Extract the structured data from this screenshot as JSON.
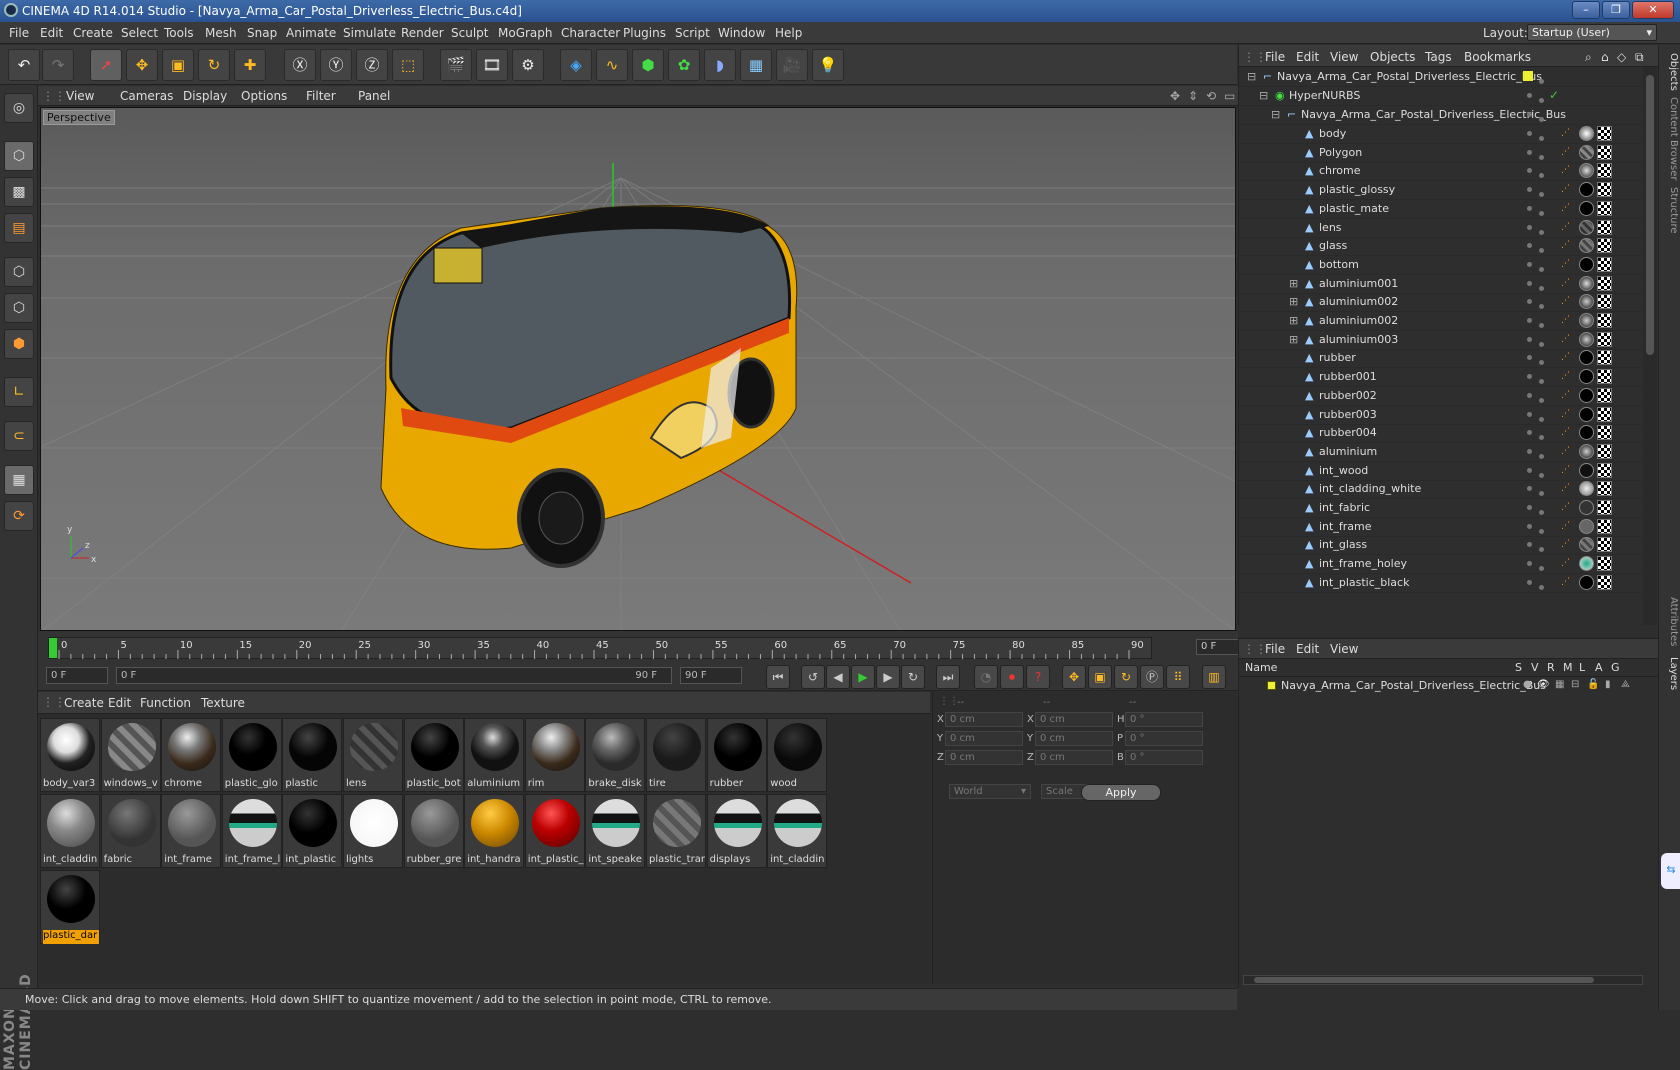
{
  "window": {
    "title": "CINEMA 4D R14.014 Studio - [Navya_Arma_Car_Postal_Driverless_Electric_Bus.c4d]"
  },
  "menu": [
    "File",
    "Edit",
    "Create",
    "Select",
    "Tools",
    "Mesh",
    "Snap",
    "Animate",
    "Simulate",
    "Render",
    "Sculpt",
    "MoGraph",
    "Character",
    "Plugins",
    "Script",
    "Window",
    "Help"
  ],
  "layout": {
    "label": "Layout:",
    "value": "Startup (User)"
  },
  "viewport": {
    "menu": [
      "View",
      "Cameras",
      "Display",
      "Options",
      "Filter",
      "Panel"
    ],
    "label": "Perspective",
    "axis_y": "y",
    "axis_x": "x",
    "axis_z": "z"
  },
  "timeline": {
    "ticks": [
      "0",
      "5",
      "10",
      "15",
      "20",
      "25",
      "30",
      "35",
      "40",
      "45",
      "50",
      "55",
      "60",
      "65",
      "70",
      "75",
      "80",
      "85",
      "90"
    ],
    "current_frame": "0 F",
    "start_field": "0 F",
    "range_start": "0 F",
    "range_end": "90 F",
    "end_field": "90 F"
  },
  "materials": {
    "menu": [
      "Create",
      "Edit",
      "Function",
      "Texture"
    ],
    "items": [
      {
        "label": "body_var3",
        "style": "radial-gradient(circle at 40% 35%,#fff,#ddd 30%,#222 55%,#000)"
      },
      {
        "label": "windows_v",
        "style": "repeating-linear-gradient(45deg,#888 0 6px,#555 6px 12px)"
      },
      {
        "label": "chrome",
        "style": "radial-gradient(circle at 40% 30%,#eee,#777 30%,#3a2a1a 60%,#111)"
      },
      {
        "label": "plastic_glo",
        "style": "radial-gradient(circle at 40% 30%,#333,#000 40%)"
      },
      {
        "label": "plastic",
        "style": "radial-gradient(circle at 40% 30%,#444,#050505 45%)"
      },
      {
        "label": "lens",
        "style": "repeating-linear-gradient(45deg,#555 0 6px,#333 6px 12px)"
      },
      {
        "label": "plastic_bot",
        "style": "radial-gradient(circle at 40% 30%,#444,#000 45%)"
      },
      {
        "label": "aluminium",
        "style": "radial-gradient(circle at 45% 30%,#ddd,#555 25%,#111 55%)"
      },
      {
        "label": "rim",
        "style": "radial-gradient(circle at 40% 30%,#eee,#888 30%,#3a2a1a 60%,#111)"
      },
      {
        "label": "brake_disk",
        "style": "radial-gradient(circle at 40% 30%,#bbb,#666 30%,#2a2a2a 60%)"
      },
      {
        "label": "tire",
        "style": "radial-gradient(circle at 40% 30%,#444,#1a1a1a 50%)"
      },
      {
        "label": "rubber",
        "style": "radial-gradient(circle at 40% 30%,#333,#000 45%)"
      },
      {
        "label": "wood",
        "style": "radial-gradient(circle at 40% 30%,#333,#0a0a0a 50%)"
      },
      {
        "label": "int_claddin",
        "style": "radial-gradient(circle at 40% 30%,#ddd,#888 40%,#444)"
      },
      {
        "label": "fabric",
        "style": "radial-gradient(circle at 40% 30%,#777,#333 60%)"
      },
      {
        "label": "int_frame",
        "style": "radial-gradient(circle at 40% 30%,#999,#555 60%)"
      },
      {
        "label": "int_frame_l",
        "style": "linear-gradient(#ddd 30%,#111 30%,#111 50%,#2a8 50%,#2a8 60%,#ccc 60%)"
      },
      {
        "label": "int_plastic",
        "style": "radial-gradient(circle at 40% 30%,#333,#000 45%)"
      },
      {
        "label": "lights",
        "style": "radial-gradient(circle,#fff,#f4f4f4)"
      },
      {
        "label": "rubber_gre",
        "style": "radial-gradient(circle at 40% 30%,#999,#555 60%)"
      },
      {
        "label": "int_handra",
        "style": "radial-gradient(circle at 40% 30%,#fc4,#c80 45%,#640)"
      },
      {
        "label": "int_plastic_",
        "style": "radial-gradient(circle at 40% 30%,#f55,#b00 40%,#500)"
      },
      {
        "label": "int_speake",
        "style": "linear-gradient(#ddd 30%,#111 30%,#111 50%,#2a8 50%,#2a8 60%,#ccc 60%)"
      },
      {
        "label": "plastic_trar",
        "style": "repeating-linear-gradient(45deg,#777 0 6px,#555 6px 12px)"
      },
      {
        "label": "displays",
        "style": "linear-gradient(#ddd 30%,#111 30%,#111 50%,#2a8 50%,#2a8 60%,#ccc 60%)"
      },
      {
        "label": "int_claddin",
        "style": "linear-gradient(#ddd 30%,#111 30%,#111 50%,#2a8 50%,#2a8 60%,#ccc 60%)"
      },
      {
        "label": "plastic_dar",
        "style": "radial-gradient(circle at 40% 30%,#444,#000 45%)"
      }
    ]
  },
  "attributes": {
    "header": [
      "--",
      "--",
      "--"
    ],
    "rows": [
      {
        "a": "X",
        "av": "0 cm",
        "b": "X",
        "bv": "0 cm",
        "c": "H",
        "cv": "0 °"
      },
      {
        "a": "Y",
        "av": "0 cm",
        "b": "Y",
        "bv": "0 cm",
        "c": "P",
        "cv": "0 °"
      },
      {
        "a": "Z",
        "av": "0 cm",
        "b": "Z",
        "bv": "0 cm",
        "c": "B",
        "cv": "0 °"
      }
    ],
    "coord_mode": "World",
    "transform_mode": "Scale",
    "apply": "Apply"
  },
  "objects": {
    "menu": [
      "File",
      "Edit",
      "View",
      "Objects",
      "Tags",
      "Bookmarks"
    ],
    "root": "Navya_Arma_Car_Postal_Driverless_Electric_Bus",
    "hypernurbs": "HyperNURBS",
    "group": "Navya_Arma_Car_Postal_Driverless_Electric_Bus",
    "items": [
      {
        "name": "body",
        "expand": false,
        "tag": "radial-gradient(#fff,#555)"
      },
      {
        "name": "Polygon",
        "expand": false,
        "tag": "repeating-linear-gradient(45deg,#888 0 3px,#444 3px 6px)"
      },
      {
        "name": "chrome",
        "expand": false,
        "tag": "radial-gradient(#ddd,#222)"
      },
      {
        "name": "plastic_glossy",
        "expand": false,
        "tag": "#000"
      },
      {
        "name": "plastic_mate",
        "expand": false,
        "tag": "#000"
      },
      {
        "name": "lens",
        "expand": false,
        "tag": "repeating-linear-gradient(45deg,#666 0 3px,#333 3px 6px)"
      },
      {
        "name": "glass",
        "expand": false,
        "tag": "repeating-linear-gradient(45deg,#777 0 3px,#444 3px 6px)"
      },
      {
        "name": "bottom",
        "expand": false,
        "tag": "#000"
      },
      {
        "name": "aluminium001",
        "expand": true,
        "tag": "radial-gradient(#ddd,#111)"
      },
      {
        "name": "aluminium002",
        "expand": true,
        "tag": "radial-gradient(#ccc,#111)"
      },
      {
        "name": "aluminium002",
        "expand": true,
        "tag": "radial-gradient(#ccc,#111)"
      },
      {
        "name": "aluminium003",
        "expand": true,
        "tag": "radial-gradient(#ccc,#111)"
      },
      {
        "name": "rubber",
        "expand": false,
        "tag": "#000"
      },
      {
        "name": "rubber001",
        "expand": false,
        "tag": "#000"
      },
      {
        "name": "rubber002",
        "expand": false,
        "tag": "#000"
      },
      {
        "name": "rubber003",
        "expand": false,
        "tag": "#000"
      },
      {
        "name": "rubber004",
        "expand": false,
        "tag": "#000"
      },
      {
        "name": "aluminium",
        "expand": false,
        "tag": "radial-gradient(#ccc,#111)"
      },
      {
        "name": "int_wood",
        "expand": false,
        "tag": "#111"
      },
      {
        "name": "int_cladding_white",
        "expand": false,
        "tag": "radial-gradient(#eee,#777)"
      },
      {
        "name": "int_fabric",
        "expand": false,
        "tag": "#333"
      },
      {
        "name": "int_frame",
        "expand": false,
        "tag": "#666"
      },
      {
        "name": "int_glass",
        "expand": false,
        "tag": "repeating-linear-gradient(45deg,#777 0 3px,#444 3px 6px)"
      },
      {
        "name": "int_frame_holey",
        "expand": false,
        "tag": "radial-gradient(#2a8,#ddd)"
      },
      {
        "name": "int_plastic_black",
        "expand": false,
        "tag": "#000"
      }
    ]
  },
  "layers": {
    "menu": [
      "File",
      "Edit",
      "View"
    ],
    "col_name": "Name",
    "cols": [
      "S",
      "V",
      "R",
      "M",
      "L",
      "A",
      "G"
    ],
    "row": "Navya_Arma_Car_Postal_Driverless_Electric_Bus"
  },
  "right_tabs": [
    "Objects",
    "Content Browser",
    "Structure",
    "Attributes",
    "Layers"
  ],
  "brand": "MAXON CINEMA 4D",
  "status": "Move: Click and drag to move elements. Hold down SHIFT to quantize movement / add to the selection in point mode, CTRL to remove."
}
